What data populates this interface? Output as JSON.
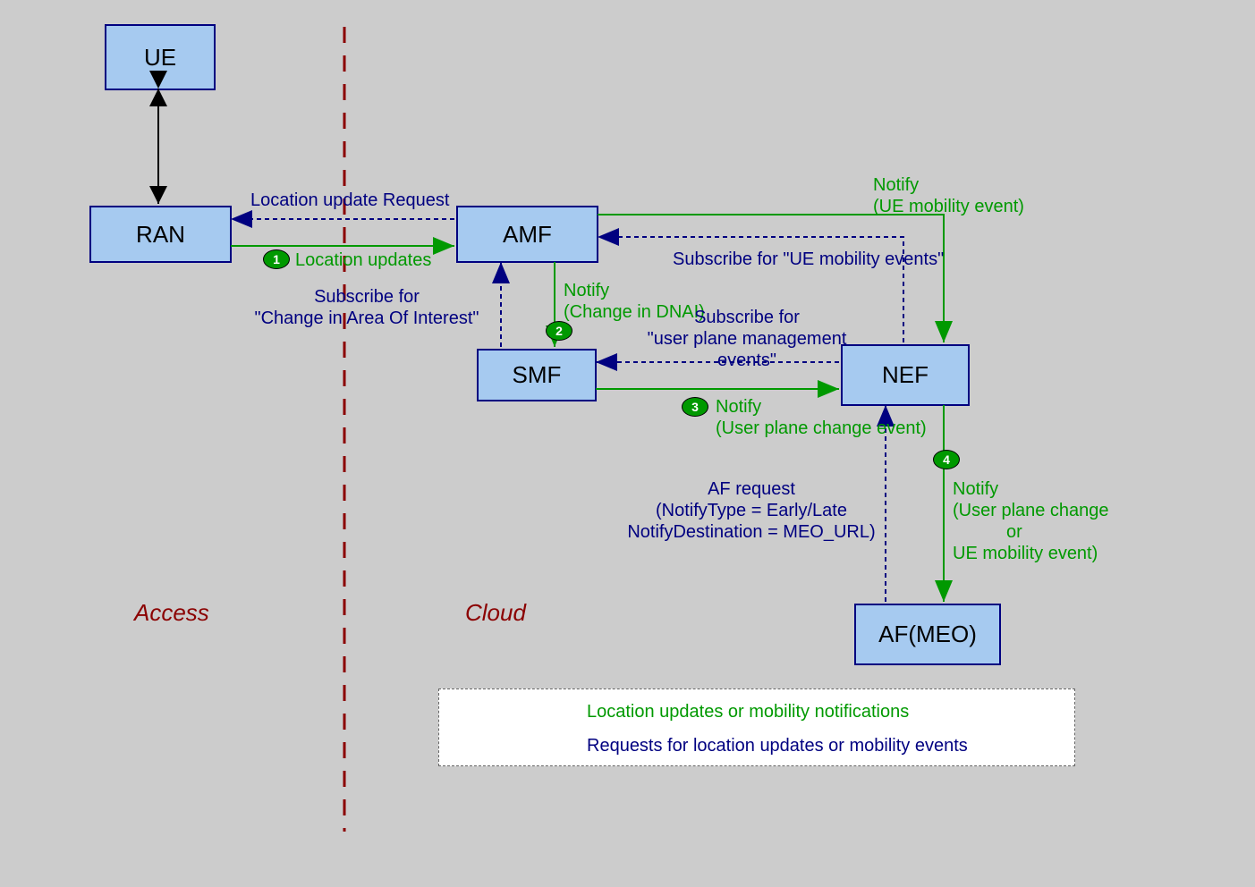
{
  "nodes": {
    "ue": "UE",
    "ran": "RAN",
    "amf": "AMF",
    "smf": "SMF",
    "nef": "NEF",
    "afmeo": "AF(MEO)"
  },
  "annotations": {
    "location_update_request": "Location update Request",
    "location_updates": "Location updates",
    "subscribe_change_aoi_1": "Subscribe for",
    "subscribe_change_aoi_2": "\"Change in Area Of Interest\"",
    "notify_dnai_1": "Notify",
    "notify_dnai_2": "(Change in DNAI)",
    "subscribe_ue_mobility": "Subscribe for \"UE mobility events\"",
    "notify_ue_mobility_1": "Notify",
    "notify_ue_mobility_2": "(UE mobility event)",
    "subscribe_upm_1": "Subscribe for",
    "subscribe_upm_2": "\"user plane management",
    "subscribe_upm_3": "events\"",
    "notify_upc_1": "Notify",
    "notify_upc_2": "(User plane change event)",
    "af_request_1": "AF request",
    "af_request_2": "(NotifyType = Early/Late",
    "af_request_3": "NotifyDestination = MEO_URL)",
    "notify_final_1": "Notify",
    "notify_final_2": "(User plane change",
    "notify_final_3": "or",
    "notify_final_4": "UE mobility event)"
  },
  "regions": {
    "access": "Access",
    "cloud": "Cloud"
  },
  "legend": {
    "green": "Location updates or mobility notifications",
    "blue": "Requests for location updates or mobility events"
  },
  "badges": {
    "b1": "1",
    "b2": "2",
    "b3": "3",
    "b4": "4"
  }
}
